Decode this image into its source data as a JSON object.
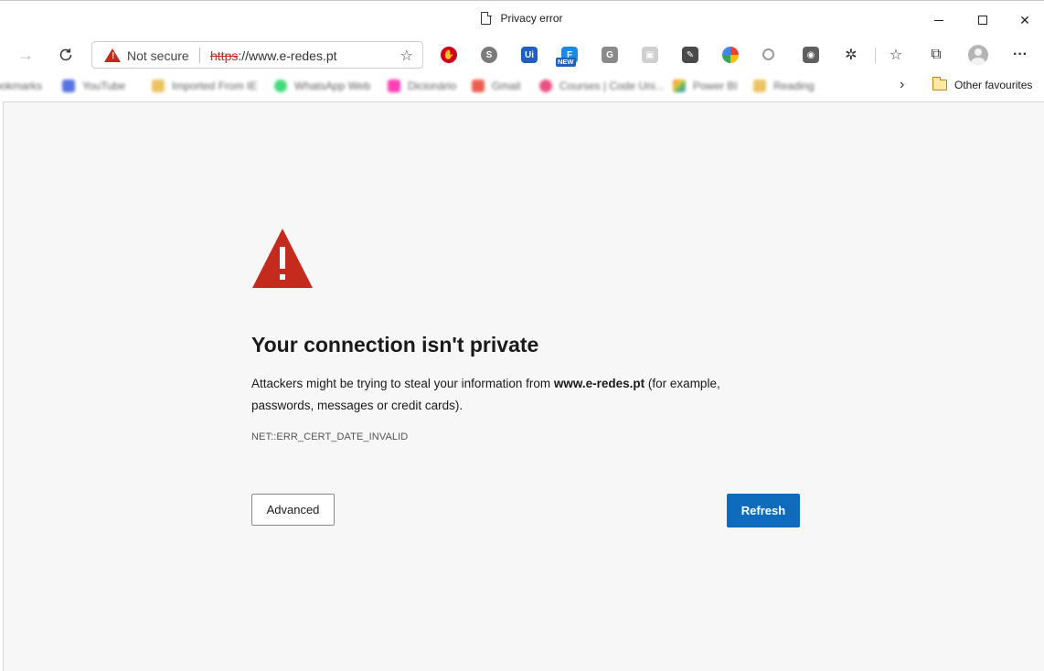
{
  "window": {
    "title": "Privacy error"
  },
  "toolbar": {
    "security_label": "Not secure",
    "url_scheme": "https",
    "url_rest": "://www.e-redes.pt"
  },
  "favourites": {
    "items": [
      {
        "label": "ookmarks",
        "color": "#999999"
      },
      {
        "label": "YouTube",
        "color": "#3a5bd9"
      },
      {
        "label": "Imported From IE",
        "color": "#e6b94a"
      },
      {
        "label": "WhatsApp Web",
        "color": "#25d366"
      },
      {
        "label": "Dicionário",
        "color": "#ff1ea8"
      },
      {
        "label": "Gmail",
        "color": "#ea4335"
      },
      {
        "label": "Courses | Code Uni...",
        "color": "#e8336a"
      },
      {
        "label": "Power BI",
        "color": "#6aa84f"
      },
      {
        "label": "Reading",
        "color": "#e6b94a"
      }
    ],
    "other_label": "Other favourites"
  },
  "error": {
    "heading": "Your connection isn't private",
    "desc_before": "Attackers might be trying to steal your information from ",
    "desc_host": "www.e-redes.pt",
    "desc_after": " (for example, passwords, messages or credit cards).",
    "code": "NET::ERR_CERT_DATE_INVALID",
    "advanced_label": "Advanced",
    "refresh_label": "Refresh"
  },
  "colors": {
    "warning_red": "#c42b1c",
    "accent_blue": "#0f6cbd",
    "page_bg": "#f7f7f7"
  }
}
